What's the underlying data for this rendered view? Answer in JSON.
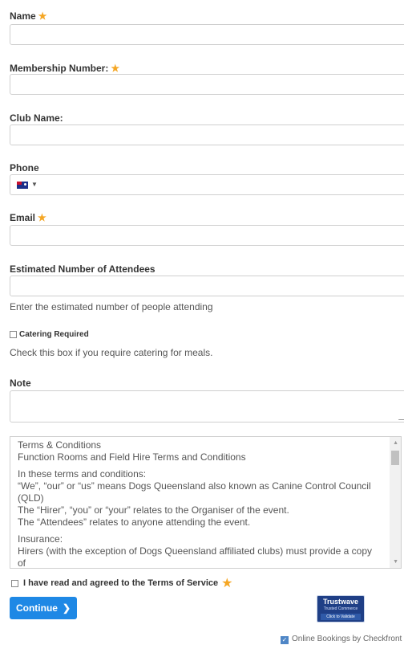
{
  "fields": {
    "name": {
      "label": "Name",
      "required": true,
      "value": "",
      "placeholder": ""
    },
    "membership": {
      "label": "Membership Number:",
      "required": true,
      "value": "",
      "placeholder": ""
    },
    "club": {
      "label": "Club Name:",
      "required": false,
      "value": "",
      "placeholder": ""
    },
    "phone": {
      "label": "Phone",
      "required": false,
      "value": "",
      "placeholder": ""
    },
    "email": {
      "label": "Email",
      "required": true,
      "value": "",
      "placeholder": ""
    },
    "attendees": {
      "label": "Estimated Number of Attendees",
      "required": false,
      "value": "",
      "placeholder": "",
      "help": "Enter the estimated number of people attending"
    },
    "note": {
      "label": "Note",
      "value": "",
      "placeholder": ""
    }
  },
  "catering": {
    "label": "Catering Required",
    "help": "Check this box if you require catering for meals."
  },
  "terms": {
    "line1": "Terms & Conditions",
    "line2": "Function Rooms and Field Hire Terms and Conditions",
    "p2a": "In these terms and conditions:",
    "p2b": "“We”, “our” or “us” means Dogs Queensland also known as Canine Control Council (QLD)",
    "p2c": "The “Hirer”, “you” or “your” relates to the Organiser of the event.",
    "p2d": "The “Attendees” relates to anyone attending the event.",
    "p3a": "Insurance:",
    "p3b": "Hirers (with the exception of Dogs Queensland affiliated clubs) must provide a copy of"
  },
  "agree": {
    "label": "I have read and agreed to the Terms of Service",
    "required": true
  },
  "buttons": {
    "continue": "Continue"
  },
  "trustwave": {
    "title": "Trustwave",
    "subtitle": "Trusted Commerce",
    "cta": "Click to Validate"
  },
  "footer": {
    "text": "Online Bookings by Checkfront"
  },
  "colors": {
    "accent": "#1e88e5",
    "required_star": "#f5a623"
  }
}
